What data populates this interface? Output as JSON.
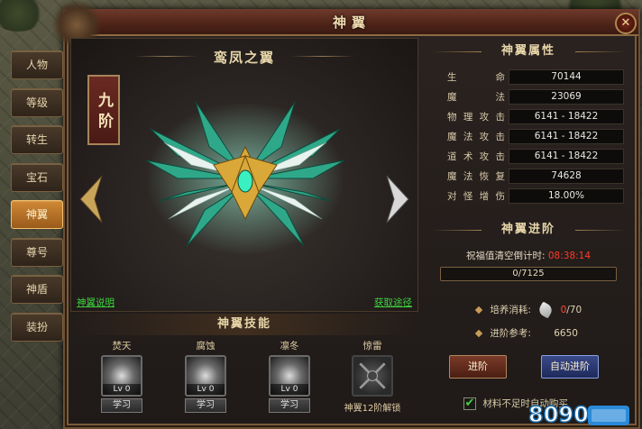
{
  "window": {
    "title": "神翼",
    "close_symbol": "✕"
  },
  "tabs": [
    "人物",
    "等级",
    "转生",
    "宝石",
    "神翼",
    "尊号",
    "神盾",
    "装扮"
  ],
  "active_tab": 4,
  "wing": {
    "name": "鸾凤之翼",
    "rank": "九阶",
    "link_left": "神翼说明",
    "link_right": "获取途径"
  },
  "skills": {
    "header": "神翼技能",
    "items": [
      {
        "name": "焚天",
        "level": "Lv 0",
        "button": "学习"
      },
      {
        "name": "腐蚀",
        "level": "Lv 0",
        "button": "学习"
      },
      {
        "name": "凛冬",
        "level": "Lv 0",
        "button": "学习"
      },
      {
        "name": "惊雷",
        "unlock": "神翼12阶解锁"
      }
    ]
  },
  "attributes": {
    "title": "神翼属性",
    "rows": [
      {
        "label": "生命",
        "value": "70144"
      },
      {
        "label": "魔法",
        "value": "23069"
      },
      {
        "label": "物理攻击",
        "value": "6141 - 18422"
      },
      {
        "label": "魔法攻击",
        "value": "6141 - 18422"
      },
      {
        "label": "道术攻击",
        "value": "6141 - 18422"
      },
      {
        "label": "魔法恢复",
        "value": "74628"
      },
      {
        "label": "对怪增伤",
        "value": "18.00%"
      }
    ]
  },
  "advance": {
    "title": "神翼进阶",
    "countdown_label": "祝福值清空倒计时:",
    "countdown_value": "08:38:14",
    "progress_text": "0/7125",
    "progress_fraction": 0.0,
    "cost_label": "培养消耗:",
    "cost_have": "0",
    "cost_need": "/70",
    "reference_label": "进阶参考:",
    "reference_value": "6650",
    "btn_advance": "进阶",
    "btn_auto": "自动进阶",
    "checkbox_label": "材料不足时自动购买"
  }
}
